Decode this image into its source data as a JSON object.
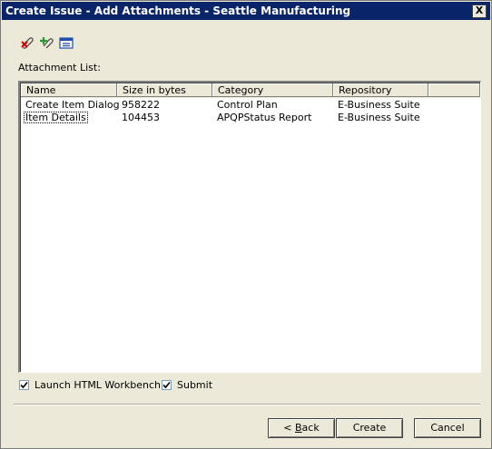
{
  "window": {
    "title": "Create Issue - Add Attachments - Seattle Manufacturing",
    "close_glyph": "X"
  },
  "toolbar": {
    "icons": [
      "remove-attachment-icon",
      "add-attachment-icon",
      "attachment-properties-icon"
    ]
  },
  "attachment_list": {
    "label": "Attachment List:",
    "columns": [
      "Name",
      "Size in bytes",
      "Category",
      "Repository"
    ],
    "rows": [
      [
        "Create Item Dialog",
        "958222",
        "Control Plan",
        "E-Business Suite"
      ],
      [
        "Item Details",
        "104453",
        "APQPStatus Report",
        "E-Business Suite"
      ]
    ]
  },
  "options": {
    "launch_label": "Launch HTML Workbench",
    "launch_checked": true,
    "submit_label": "Submit",
    "submit_checked": true
  },
  "buttons": {
    "back_prefix": "< ",
    "back_mnemonic": "B",
    "back_rest": "ack",
    "create": "Create",
    "cancel": "Cancel"
  }
}
